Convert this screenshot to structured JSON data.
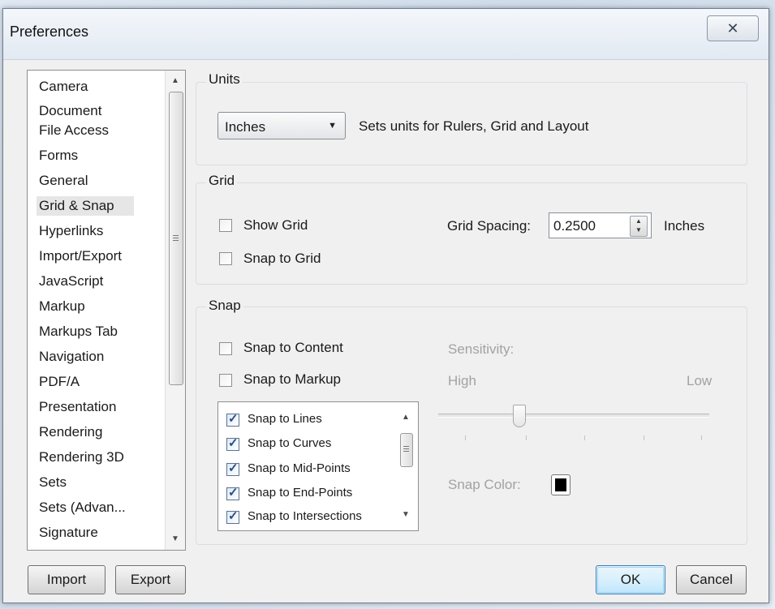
{
  "window": {
    "title": "Preferences",
    "close_glyph": "✕"
  },
  "categories": {
    "items": [
      {
        "label": "Camera"
      },
      {
        "label": "Document"
      },
      {
        "label": "File Access"
      },
      {
        "label": "Forms"
      },
      {
        "label": "General"
      },
      {
        "label": "Grid & Snap",
        "selected": true
      },
      {
        "label": "Hyperlinks"
      },
      {
        "label": "Import/Export"
      },
      {
        "label": "JavaScript"
      },
      {
        "label": "Markup"
      },
      {
        "label": "Markups Tab"
      },
      {
        "label": "Navigation"
      },
      {
        "label": "PDF/A"
      },
      {
        "label": "Presentation"
      },
      {
        "label": "Rendering"
      },
      {
        "label": "Rendering 3D"
      },
      {
        "label": "Sets"
      },
      {
        "label": "Sets (Advan..."
      },
      {
        "label": "Signature"
      }
    ],
    "selected": "Grid & Snap"
  },
  "units": {
    "group_label": "Units",
    "selected": "Inches",
    "description": "Sets units for Rulers, Grid and Layout"
  },
  "grid": {
    "group_label": "Grid",
    "show_grid": {
      "label": "Show Grid",
      "checked": false
    },
    "snap_to_grid": {
      "label": "Snap to Grid",
      "checked": false
    },
    "spacing_label": "Grid Spacing:",
    "spacing_value": "0.2500",
    "spacing_units": "Inches"
  },
  "snap": {
    "group_label": "Snap",
    "snap_to_content": {
      "label": "Snap to Content",
      "checked": false
    },
    "snap_to_markup": {
      "label": "Snap to Markup",
      "checked": false
    },
    "options": [
      {
        "label": "Snap to Lines",
        "checked": true
      },
      {
        "label": "Snap to Curves",
        "checked": true
      },
      {
        "label": "Snap to Mid-Points",
        "checked": true
      },
      {
        "label": "Snap to End-Points",
        "checked": true
      },
      {
        "label": "Snap to Intersections",
        "checked": true
      }
    ],
    "sensitivity_label": "Sensitivity:",
    "high_label": "High",
    "low_label": "Low",
    "sensitivity_level": 0.3,
    "snap_color_label": "Snap Color:",
    "snap_color": "#000000"
  },
  "footer": {
    "import_label": "Import",
    "export_label": "Export",
    "ok_label": "OK",
    "cancel_label": "Cancel"
  }
}
